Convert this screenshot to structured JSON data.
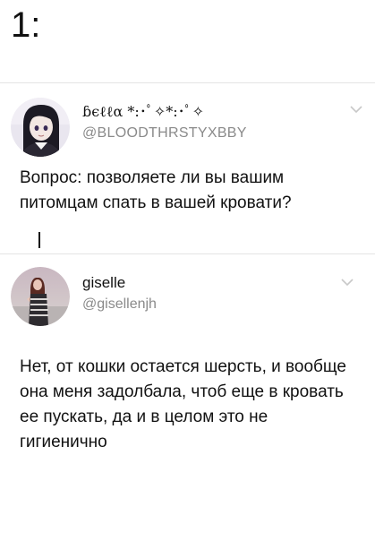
{
  "post_number": "1:",
  "tweets": [
    {
      "display_name": "ɓєℓℓα *:･ﾟ✧*:･ﾟ✧",
      "handle": "@BLOODTHRSTYXBBY",
      "text": "Вопрос: позволяете ли вы вашим питомцам спать в вашей кровати?",
      "avatar_icon": "anime-girl-avatar"
    },
    {
      "display_name": "giselle",
      "handle": "@gisellenjh",
      "text": "Нет, от кошки остается шерсть, и вообще она меня задолбала, чтоб еще в кровать ее пускать, да и в целом это не гигиенично",
      "avatar_icon": "photo-portrait-avatar"
    }
  ],
  "icons": {
    "menu": "chevron-down-icon"
  },
  "colors": {
    "text": "#111111",
    "handle": "#8a8a8a",
    "divider": "#e4e4e4",
    "chevron": "#c8c8c8"
  }
}
